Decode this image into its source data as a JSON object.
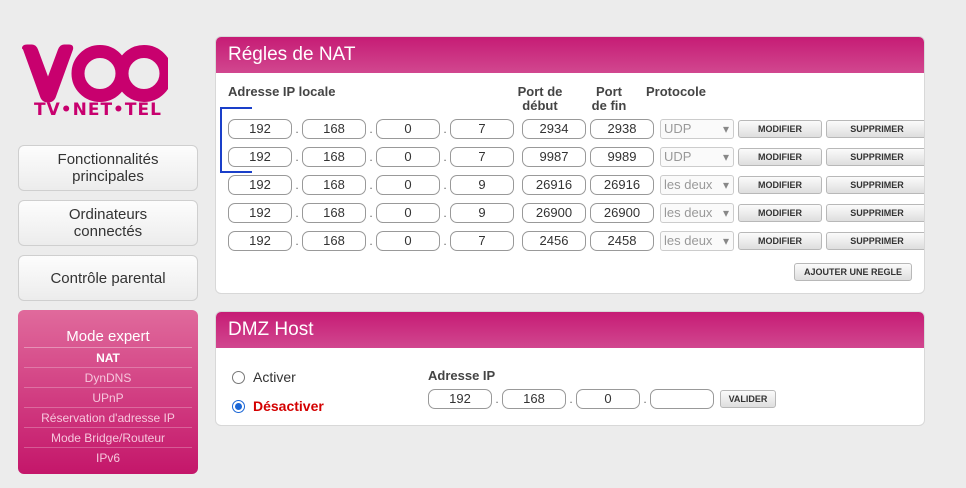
{
  "logo": {
    "brand": "VOO",
    "tagline": "TV•NET•TEL"
  },
  "sidebar": {
    "items": [
      {
        "label_line1": "Fonctionnalités",
        "label_line2": "principales"
      },
      {
        "label_line1": "Ordinateurs",
        "label_line2": "connectés"
      },
      {
        "label_line1": "Contrôle parental",
        "label_line2": ""
      }
    ],
    "expert": {
      "title": "Mode expert",
      "items": [
        "NAT",
        "DynDNS",
        "UPnP",
        "Réservation d'adresse IP",
        "Mode Bridge/Routeur",
        "IPv6"
      ]
    }
  },
  "nat": {
    "title": "Régles de NAT",
    "headers": {
      "ip": "Adresse IP locale",
      "port_start_1": "Port de",
      "port_start_2": "début",
      "port_end_1": "Port",
      "port_end_2": "de fin",
      "protocol": "Protocole"
    },
    "rows": [
      {
        "ip": [
          "192",
          "168",
          "0",
          "7"
        ],
        "port_start": "2934",
        "port_end": "2938",
        "protocol": "UDP"
      },
      {
        "ip": [
          "192",
          "168",
          "0",
          "7"
        ],
        "port_start": "9987",
        "port_end": "9989",
        "protocol": "UDP"
      },
      {
        "ip": [
          "192",
          "168",
          "0",
          "9"
        ],
        "port_start": "26916",
        "port_end": "26916",
        "protocol": "les deux"
      },
      {
        "ip": [
          "192",
          "168",
          "0",
          "9"
        ],
        "port_start": "26900",
        "port_end": "26900",
        "protocol": "les deux"
      },
      {
        "ip": [
          "192",
          "168",
          "0",
          "7"
        ],
        "port_start": "2456",
        "port_end": "2458",
        "protocol": "les deux"
      }
    ],
    "modify_label": "MODIFIER",
    "delete_label": "SUPPRIMER",
    "add_label": "AJOUTER UNE REGLE"
  },
  "dmz": {
    "title": "DMZ Host",
    "activate_label": "Activer",
    "deactivate_label": "Désactiver",
    "ip_label": "Adresse IP",
    "ip": [
      "192",
      "168",
      "0",
      ""
    ],
    "validate_label": "VALIDER"
  },
  "colors": {
    "accent": "#c61c75",
    "selected_radio": "#1a66d6"
  }
}
